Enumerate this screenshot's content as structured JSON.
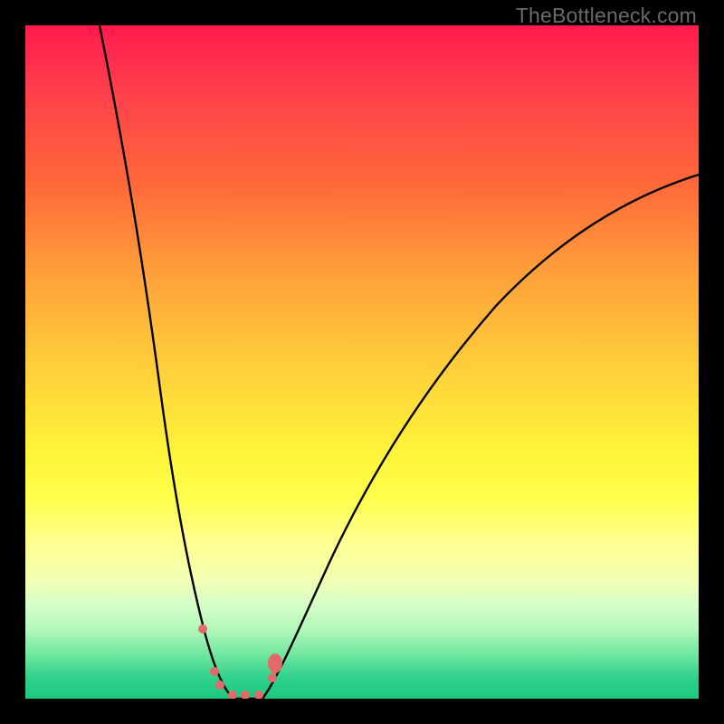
{
  "watermark": "TheBottleneck.com",
  "colors": {
    "frame": "#000000",
    "curve": "#000000",
    "marker": "#e46a6a",
    "gradient_top": "#ff1a4d",
    "gradient_bottom": "#1ec97f"
  },
  "chart_data": {
    "type": "line",
    "title": "",
    "xlabel": "",
    "ylabel": "",
    "xlim": [
      0,
      100
    ],
    "ylim": [
      0,
      100
    ],
    "note": "No visible axis ticks or numeric labels. Values below are eyeballed from pixel positions. y=100 near top (red / high bottleneck), y=0 near bottom (green / low bottleneck).",
    "series": [
      {
        "name": "left-branch",
        "x": [
          11,
          14,
          17,
          19,
          21,
          23,
          25,
          26.5,
          28,
          29.5,
          31
        ],
        "y": [
          100,
          84,
          66,
          52,
          39,
          27,
          16,
          9,
          3.5,
          1,
          0
        ]
      },
      {
        "name": "right-branch",
        "x": [
          35,
          37,
          40,
          44,
          49,
          55,
          62,
          70,
          79,
          89,
          100
        ],
        "y": [
          0,
          3,
          9,
          17,
          27,
          37,
          47,
          56,
          64,
          71,
          78
        ]
      }
    ],
    "markers": {
      "name": "highlighted-points",
      "shape": "circle",
      "color": "#e46a6a",
      "points": [
        {
          "x": 26.3,
          "y": 9.9,
          "r": 1.3
        },
        {
          "x": 28.1,
          "y": 3.6,
          "r": 1.3
        },
        {
          "x": 28.9,
          "y": 1.6,
          "r": 1.3
        },
        {
          "x": 30.8,
          "y": 0.1,
          "r": 1.3
        },
        {
          "x": 32.7,
          "y": 0.1,
          "r": 1.3
        },
        {
          "x": 34.7,
          "y": 0.1,
          "r": 1.3
        },
        {
          "x": 36.7,
          "y": 2.7,
          "r": 1.3
        },
        {
          "x": 37.2,
          "y": 4.7,
          "r": 2.2
        }
      ]
    }
  }
}
